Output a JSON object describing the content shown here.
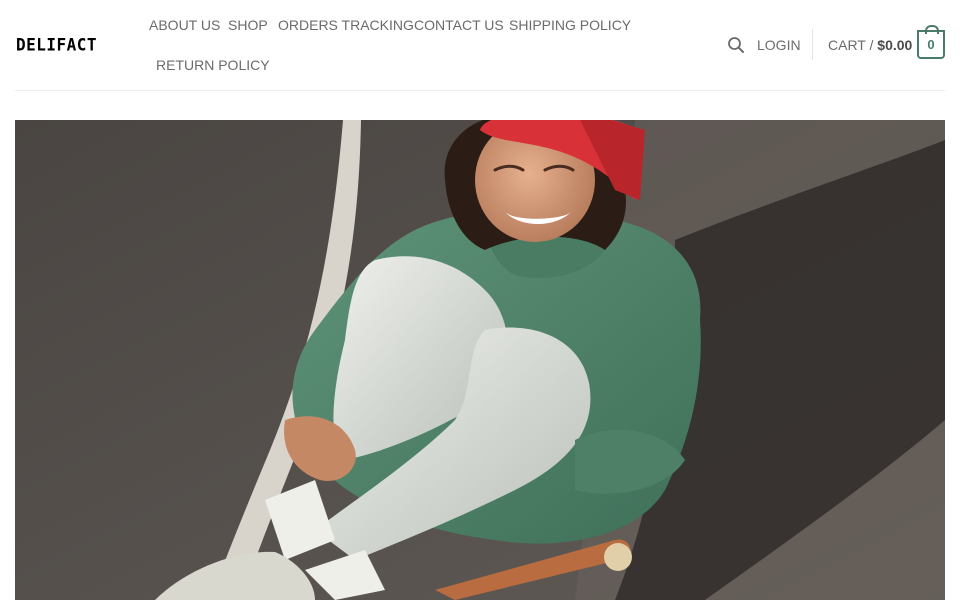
{
  "site": {
    "logo": "DELIFACT"
  },
  "nav": {
    "items": [
      {
        "label": "ABOUT US"
      },
      {
        "label": "SHOP"
      },
      {
        "label": "ORDERS TRACKING"
      },
      {
        "label": "CONTACT US"
      },
      {
        "label": "SHIPPING POLICY"
      },
      {
        "label": "RETURN POLICY"
      }
    ]
  },
  "header_right": {
    "search_icon": "search-icon",
    "login_label": "LOGIN",
    "cart_label": "CART /",
    "cart_amount": "$0.00",
    "cart_count": "0",
    "accent_color": "#4a7b6a"
  },
  "hero": {
    "image_icon": "hero-image"
  }
}
